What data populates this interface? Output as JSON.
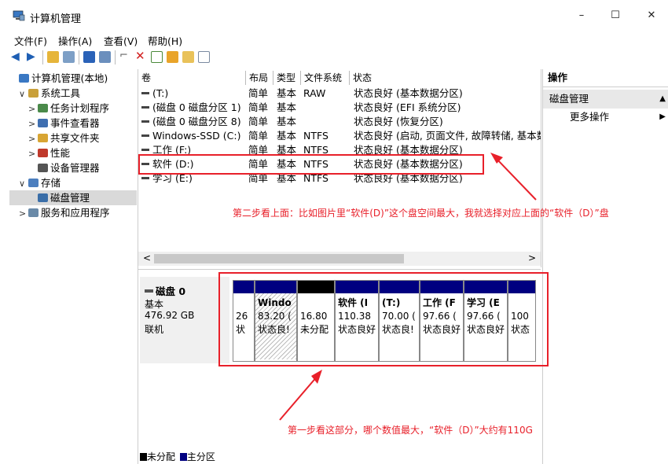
{
  "window": {
    "title": "计算机管理",
    "minimize": "–",
    "maximize": "☐",
    "close": "✕"
  },
  "menu": [
    "文件(F)",
    "操作(A)",
    "查看(V)",
    "帮助(H)"
  ],
  "tree": [
    {
      "label": "计算机管理(本地)",
      "chev": "",
      "icon": "computer-management-icon",
      "indent": 0
    },
    {
      "label": "系统工具",
      "chev": "∨",
      "icon": "system-tools-icon",
      "indent": 1
    },
    {
      "label": "任务计划程序",
      "chev": ">",
      "icon": "task-scheduler-icon",
      "indent": 2
    },
    {
      "label": "事件查看器",
      "chev": ">",
      "icon": "event-viewer-icon",
      "indent": 2
    },
    {
      "label": "共享文件夹",
      "chev": ">",
      "icon": "shared-folders-icon",
      "indent": 2
    },
    {
      "label": "性能",
      "chev": ">",
      "icon": "performance-icon",
      "indent": 2
    },
    {
      "label": "设备管理器",
      "chev": "",
      "icon": "device-manager-icon",
      "indent": 2
    },
    {
      "label": "存储",
      "chev": "∨",
      "icon": "storage-icon",
      "indent": 1
    },
    {
      "label": "磁盘管理",
      "chev": "",
      "icon": "disk-management-icon",
      "indent": 2
    },
    {
      "label": "服务和应用程序",
      "chev": ">",
      "icon": "services-apps-icon",
      "indent": 1
    }
  ],
  "volumes": {
    "headers": [
      "卷",
      "布局",
      "类型",
      "文件系统",
      "状态"
    ],
    "rows": [
      [
        "(T:)",
        "简单",
        "基本",
        "RAW",
        "状态良好 (基本数据分区)"
      ],
      [
        "(磁盘 0 磁盘分区 1)",
        "简单",
        "基本",
        "",
        "状态良好 (EFI 系统分区)"
      ],
      [
        "(磁盘 0 磁盘分区 8)",
        "简单",
        "基本",
        "",
        "状态良好 (恢复分区)"
      ],
      [
        "Windows-SSD (C:)",
        "简单",
        "基本",
        "NTFS",
        "状态良好 (启动, 页面文件, 故障转储, 基本数"
      ],
      [
        "工作 (F:)",
        "简单",
        "基本",
        "NTFS",
        "状态良好 (基本数据分区)"
      ],
      [
        "软件 (D:)",
        "简单",
        "基本",
        "NTFS",
        "状态良好 (基本数据分区)"
      ],
      [
        "学习 (E:)",
        "简单",
        "基本",
        "NTFS",
        "状态良好 (基本数据分区)"
      ]
    ],
    "scroll_left": "<",
    "scroll_right": ">"
  },
  "disk": {
    "name": "磁盘 0",
    "type": "基本",
    "size": "476.92 GB",
    "status": "联机",
    "partitions": [
      {
        "name": "",
        "size": "26",
        "status": "状",
        "bar": "blue",
        "hatched": false
      },
      {
        "name": "Windo",
        "size": "83.20 (",
        "status": "状态良!",
        "bar": "blue",
        "hatched": true
      },
      {
        "name": "",
        "size": "16.80",
        "status": "未分配",
        "bar": "black",
        "hatched": false
      },
      {
        "name": "软件 (I",
        "size": "110.38",
        "status": "状态良好",
        "bar": "blue",
        "hatched": false
      },
      {
        "name": "(T:)",
        "size": "70.00 (",
        "status": "状态良!",
        "bar": "blue",
        "hatched": false
      },
      {
        "name": "工作 (F",
        "size": "97.66 (",
        "status": "状态良好",
        "bar": "blue",
        "hatched": false
      },
      {
        "name": "学习 (E",
        "size": "97.66 (",
        "status": "状态良好",
        "bar": "blue",
        "hatched": false
      },
      {
        "name": "",
        "size": "100",
        "status": "状态",
        "bar": "blue",
        "hatched": false
      }
    ]
  },
  "legend": {
    "unallocated": "未分配",
    "primary": "主分区"
  },
  "actions": {
    "header": "操作",
    "section": "磁盘管理",
    "more": "更多操作"
  },
  "annotations": {
    "step2": "第二步看上面：比如图片里“软件(D)”这个盘空间最大，我就选择对应上面的“软件（D）”盘",
    "step1": "第一步看这部分，哪个数值最大，“软件（D）”大约有110G"
  },
  "colors": {
    "accent_red": "#e8202a",
    "partition_blue": "#000080"
  }
}
